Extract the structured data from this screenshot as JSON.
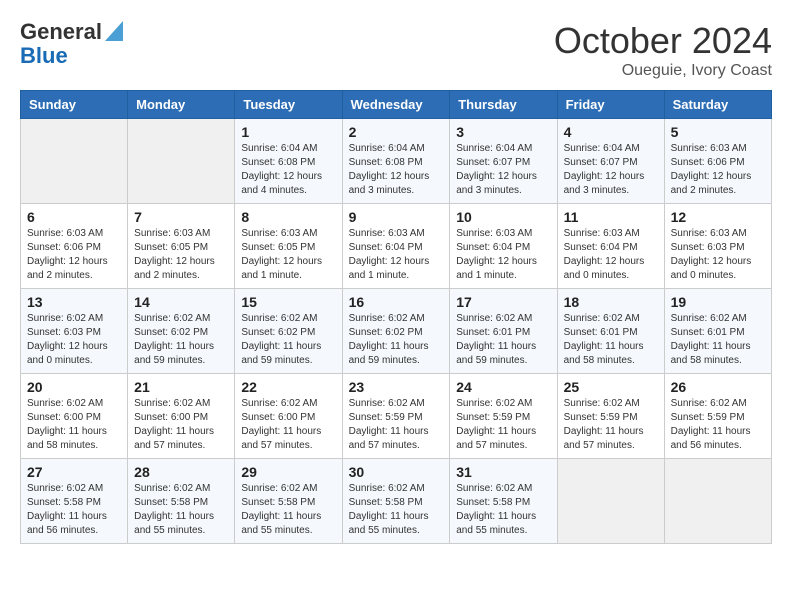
{
  "logo": {
    "line1": "General",
    "line2": "Blue"
  },
  "title": "October 2024",
  "subtitle": "Oueguie, Ivory Coast",
  "weekdays": [
    "Sunday",
    "Monday",
    "Tuesday",
    "Wednesday",
    "Thursday",
    "Friday",
    "Saturday"
  ],
  "weeks": [
    [
      {
        "day": "",
        "detail": ""
      },
      {
        "day": "",
        "detail": ""
      },
      {
        "day": "1",
        "detail": "Sunrise: 6:04 AM\nSunset: 6:08 PM\nDaylight: 12 hours and 4 minutes."
      },
      {
        "day": "2",
        "detail": "Sunrise: 6:04 AM\nSunset: 6:08 PM\nDaylight: 12 hours and 3 minutes."
      },
      {
        "day": "3",
        "detail": "Sunrise: 6:04 AM\nSunset: 6:07 PM\nDaylight: 12 hours and 3 minutes."
      },
      {
        "day": "4",
        "detail": "Sunrise: 6:04 AM\nSunset: 6:07 PM\nDaylight: 12 hours and 3 minutes."
      },
      {
        "day": "5",
        "detail": "Sunrise: 6:03 AM\nSunset: 6:06 PM\nDaylight: 12 hours and 2 minutes."
      }
    ],
    [
      {
        "day": "6",
        "detail": "Sunrise: 6:03 AM\nSunset: 6:06 PM\nDaylight: 12 hours and 2 minutes."
      },
      {
        "day": "7",
        "detail": "Sunrise: 6:03 AM\nSunset: 6:05 PM\nDaylight: 12 hours and 2 minutes."
      },
      {
        "day": "8",
        "detail": "Sunrise: 6:03 AM\nSunset: 6:05 PM\nDaylight: 12 hours and 1 minute."
      },
      {
        "day": "9",
        "detail": "Sunrise: 6:03 AM\nSunset: 6:04 PM\nDaylight: 12 hours and 1 minute."
      },
      {
        "day": "10",
        "detail": "Sunrise: 6:03 AM\nSunset: 6:04 PM\nDaylight: 12 hours and 1 minute."
      },
      {
        "day": "11",
        "detail": "Sunrise: 6:03 AM\nSunset: 6:04 PM\nDaylight: 12 hours and 0 minutes."
      },
      {
        "day": "12",
        "detail": "Sunrise: 6:03 AM\nSunset: 6:03 PM\nDaylight: 12 hours and 0 minutes."
      }
    ],
    [
      {
        "day": "13",
        "detail": "Sunrise: 6:02 AM\nSunset: 6:03 PM\nDaylight: 12 hours and 0 minutes."
      },
      {
        "day": "14",
        "detail": "Sunrise: 6:02 AM\nSunset: 6:02 PM\nDaylight: 11 hours and 59 minutes."
      },
      {
        "day": "15",
        "detail": "Sunrise: 6:02 AM\nSunset: 6:02 PM\nDaylight: 11 hours and 59 minutes."
      },
      {
        "day": "16",
        "detail": "Sunrise: 6:02 AM\nSunset: 6:02 PM\nDaylight: 11 hours and 59 minutes."
      },
      {
        "day": "17",
        "detail": "Sunrise: 6:02 AM\nSunset: 6:01 PM\nDaylight: 11 hours and 59 minutes."
      },
      {
        "day": "18",
        "detail": "Sunrise: 6:02 AM\nSunset: 6:01 PM\nDaylight: 11 hours and 58 minutes."
      },
      {
        "day": "19",
        "detail": "Sunrise: 6:02 AM\nSunset: 6:01 PM\nDaylight: 11 hours and 58 minutes."
      }
    ],
    [
      {
        "day": "20",
        "detail": "Sunrise: 6:02 AM\nSunset: 6:00 PM\nDaylight: 11 hours and 58 minutes."
      },
      {
        "day": "21",
        "detail": "Sunrise: 6:02 AM\nSunset: 6:00 PM\nDaylight: 11 hours and 57 minutes."
      },
      {
        "day": "22",
        "detail": "Sunrise: 6:02 AM\nSunset: 6:00 PM\nDaylight: 11 hours and 57 minutes."
      },
      {
        "day": "23",
        "detail": "Sunrise: 6:02 AM\nSunset: 5:59 PM\nDaylight: 11 hours and 57 minutes."
      },
      {
        "day": "24",
        "detail": "Sunrise: 6:02 AM\nSunset: 5:59 PM\nDaylight: 11 hours and 57 minutes."
      },
      {
        "day": "25",
        "detail": "Sunrise: 6:02 AM\nSunset: 5:59 PM\nDaylight: 11 hours and 57 minutes."
      },
      {
        "day": "26",
        "detail": "Sunrise: 6:02 AM\nSunset: 5:59 PM\nDaylight: 11 hours and 56 minutes."
      }
    ],
    [
      {
        "day": "27",
        "detail": "Sunrise: 6:02 AM\nSunset: 5:58 PM\nDaylight: 11 hours and 56 minutes."
      },
      {
        "day": "28",
        "detail": "Sunrise: 6:02 AM\nSunset: 5:58 PM\nDaylight: 11 hours and 55 minutes."
      },
      {
        "day": "29",
        "detail": "Sunrise: 6:02 AM\nSunset: 5:58 PM\nDaylight: 11 hours and 55 minutes."
      },
      {
        "day": "30",
        "detail": "Sunrise: 6:02 AM\nSunset: 5:58 PM\nDaylight: 11 hours and 55 minutes."
      },
      {
        "day": "31",
        "detail": "Sunrise: 6:02 AM\nSunset: 5:58 PM\nDaylight: 11 hours and 55 minutes."
      },
      {
        "day": "",
        "detail": ""
      },
      {
        "day": "",
        "detail": ""
      }
    ]
  ]
}
